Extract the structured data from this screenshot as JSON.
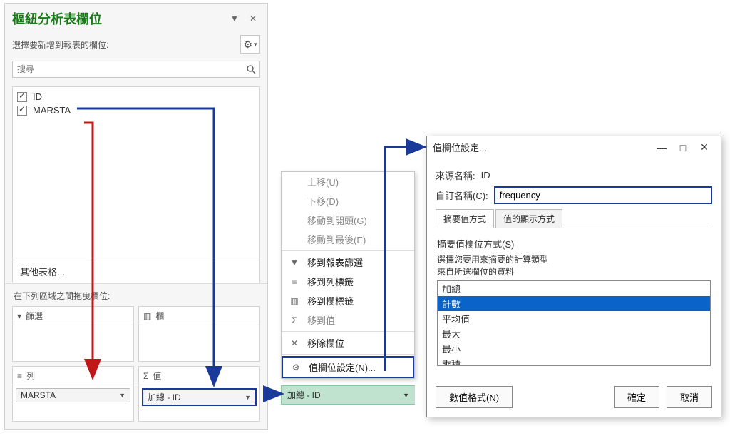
{
  "pane": {
    "title": "樞紐分析表欄位",
    "instruction": "選擇要新增到報表的欄位:",
    "search_placeholder": "搜尋",
    "fields": [
      {
        "name": "ID",
        "checked": true
      },
      {
        "name": "MARSTA",
        "checked": true
      }
    ],
    "other_tables": "其他表格...",
    "drag_instruction": "在下列區域之間拖曳欄位:",
    "zones": {
      "filter": {
        "label": "篩選"
      },
      "column": {
        "label": "欄"
      },
      "row": {
        "label": "列",
        "item": "MARSTA"
      },
      "values": {
        "label": "值",
        "item": "加總 - ID"
      }
    }
  },
  "context_menu": {
    "items": [
      {
        "label": "上移(U)",
        "enabled": false
      },
      {
        "label": "下移(D)",
        "enabled": false
      },
      {
        "label": "移動到開頭(G)",
        "enabled": false
      },
      {
        "label": "移動到最後(E)",
        "enabled": false
      },
      {
        "label": "移到報表篩選",
        "enabled": true,
        "icon": "funnel"
      },
      {
        "label": "移到列標籤",
        "enabled": true,
        "icon": "rows"
      },
      {
        "label": "移到欄標籤",
        "enabled": true,
        "icon": "cols"
      },
      {
        "label": "移到值",
        "enabled": false,
        "icon": "sigma"
      },
      {
        "label": "移除欄位",
        "enabled": true,
        "icon": "x"
      },
      {
        "label": "值欄位設定(N)...",
        "enabled": true,
        "icon": "gear",
        "highlight": true
      }
    ],
    "current_pill": "加總 - ID"
  },
  "dialog": {
    "title": "值欄位設定...",
    "source_label": "來源名稱:",
    "source_value": "ID",
    "custom_label": "自訂名稱(C):",
    "custom_value": "frequency",
    "tabs": {
      "summary": "摘要值方式",
      "display": "值的顯示方式"
    },
    "summary_heading": "摘要值欄位方式(S)",
    "summary_desc1": "選擇您要用來摘要的計算類型",
    "summary_desc2": "來自所選欄位的資料",
    "funcs": [
      "加總",
      "計數",
      "平均值",
      "最大",
      "最小",
      "乘積"
    ],
    "selected_func_index": 1,
    "number_format_btn": "數值格式(N)",
    "ok": "確定",
    "cancel": "取消"
  },
  "win_buttons": {
    "min": "—",
    "max": "□",
    "close": "✕"
  }
}
